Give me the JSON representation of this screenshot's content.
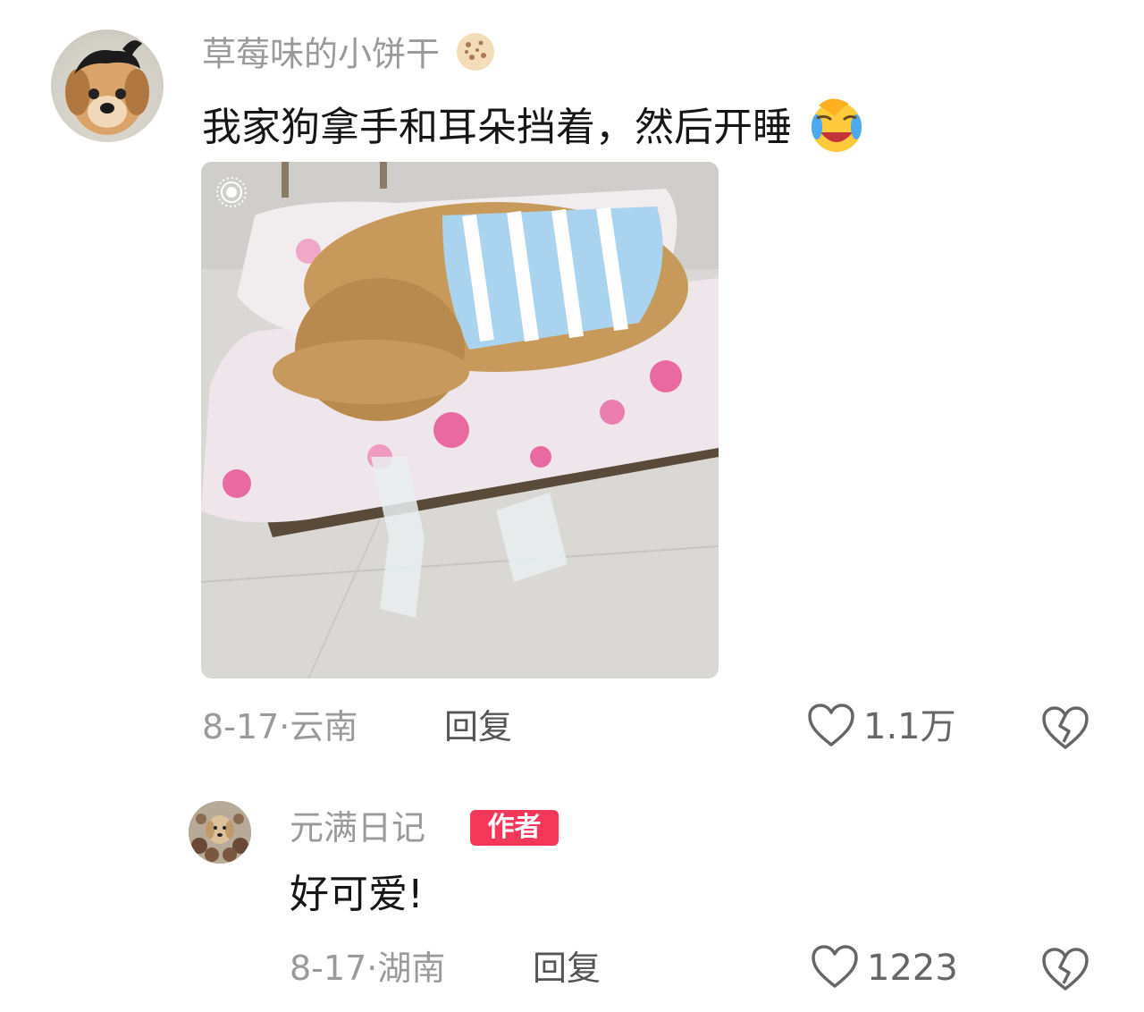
{
  "comment": {
    "username": "草莓味的小饼干",
    "username_emoji": "cookie-emoji",
    "text": "我家狗拿手和耳朵挡着，然后开睡",
    "text_emoji": "face-palm-crying-emoji",
    "date": "8-17",
    "location": "云南",
    "reply_label": "回复",
    "like_count": "1.1万"
  },
  "reply": {
    "username": "元满日记",
    "badge": "作者",
    "text": "好可爱!",
    "date": "8-17",
    "location": "湖南",
    "reply_label": "回复",
    "like_count": "1223"
  },
  "colors": {
    "badge_bg": "#f5385a",
    "meta_gray": "#9a9a9a",
    "text_dark": "#161616"
  },
  "icons": [
    "heart-outline-icon",
    "broken-heart-icon",
    "live-photo-icon"
  ]
}
